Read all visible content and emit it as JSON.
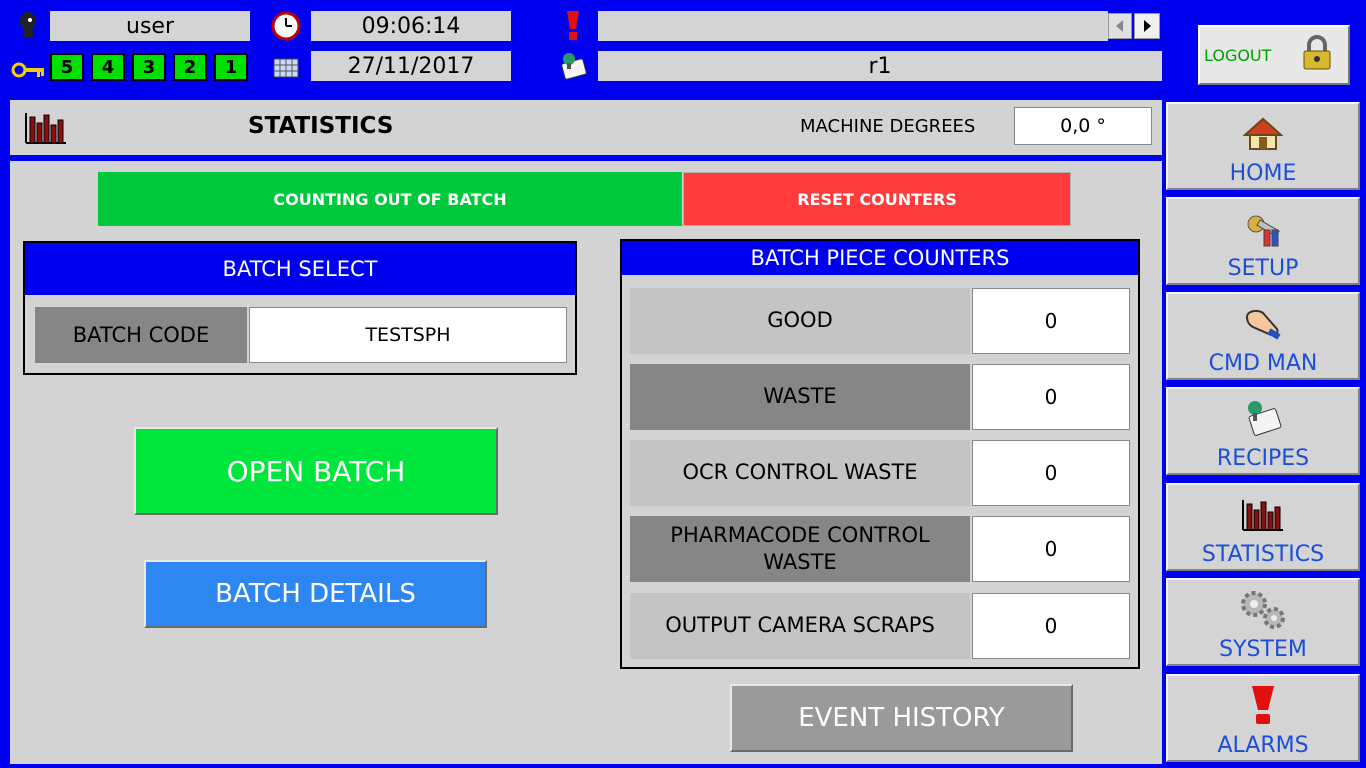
{
  "header": {
    "user": "user",
    "time": "09:06:14",
    "date": "27/11/2017",
    "levels": [
      "5",
      "4",
      "3",
      "2",
      "1"
    ],
    "alarm_text": "",
    "recipe": "r1",
    "logout_label": "LOGOUT"
  },
  "title_bar": {
    "title": "STATISTICS",
    "machine_degrees_label": "MACHINE DEGREES",
    "machine_degrees_value": "0,0 °"
  },
  "actions": {
    "counting_label": "COUNTING OUT OF BATCH",
    "reset_label": "RESET COUNTERS",
    "open_batch_label": "OPEN BATCH",
    "batch_details_label": "BATCH DETAILS",
    "event_history_label": "EVENT HISTORY"
  },
  "batch_select": {
    "title": "BATCH SELECT",
    "code_label": "BATCH CODE",
    "code_value": "TESTSPH"
  },
  "counters": {
    "title": "BATCH PIECE COUNTERS",
    "rows": [
      {
        "label": "GOOD",
        "value": "0"
      },
      {
        "label": "WASTE",
        "value": "0"
      },
      {
        "label": "OCR CONTROL WASTE",
        "value": "0"
      },
      {
        "label": "PHARMACODE CONTROL WASTE",
        "value": "0"
      },
      {
        "label": "OUTPUT CAMERA SCRAPS",
        "value": "0"
      }
    ]
  },
  "nav": [
    {
      "label": "HOME",
      "icon": "home-icon"
    },
    {
      "label": "SETUP",
      "icon": "setup-icon"
    },
    {
      "label": "CMD MAN",
      "icon": "hand-icon"
    },
    {
      "label": "RECIPES",
      "icon": "recipes-icon"
    },
    {
      "label": "STATISTICS",
      "icon": "statistics-icon"
    },
    {
      "label": "SYSTEM",
      "icon": "gears-icon"
    },
    {
      "label": "ALARMS",
      "icon": "alarm-icon"
    }
  ],
  "colors": {
    "frame": "#0000f0",
    "counting_green": "#00c83c",
    "reset_red": "#ff3b3b",
    "open_green": "#00e63c",
    "details_blue": "#2e86f0",
    "history_gray": "#9a9a9a"
  }
}
